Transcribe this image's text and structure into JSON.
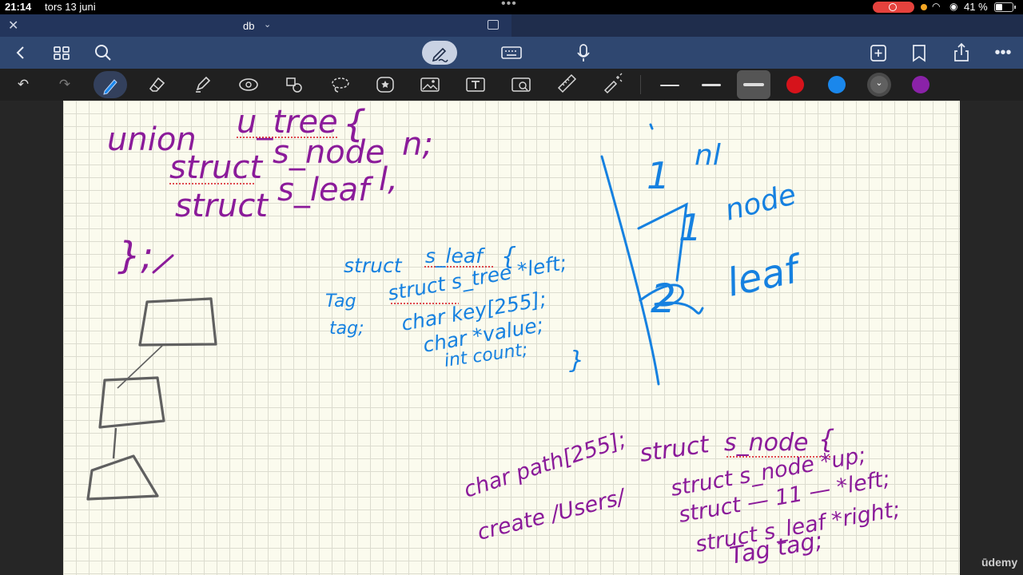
{
  "status": {
    "time": "21:14",
    "date": "tors 13 juni",
    "battery": "41 %",
    "battery_level": 0.41
  },
  "document": {
    "title": "db"
  },
  "icons": {
    "close": "close-icon",
    "back": "chevron-left-icon",
    "grid": "grid-icon",
    "search": "search-icon",
    "pen_mode": "pen-scribble-icon",
    "keyboard": "keyboard-icon",
    "mic": "microphone-icon",
    "add_page": "add-page-icon",
    "bookmark": "bookmark-icon",
    "share": "share-icon",
    "more": "more-icon",
    "undo": "undo-icon",
    "redo": "redo-icon",
    "pen": "pen-icon",
    "eraser": "eraser-icon",
    "highlighter": "highlighter-icon",
    "shapes": "shapes-icon",
    "elements": "elements-icon",
    "lasso": "lasso-icon",
    "sticker": "sticker-icon",
    "image": "image-icon",
    "text": "text-icon",
    "scan": "scan-icon",
    "ruler": "ruler-icon",
    "laser": "laser-pointer-icon"
  },
  "colors": {
    "purple": "#8b1b9a",
    "blue": "#1681e0",
    "red": "#d6131b",
    "swatch_blue": "#1a87ec",
    "gray": "#606060",
    "swatch_purple": "#8a22a8"
  },
  "notes": {
    "purple_union": {
      "line1_a": "union",
      "line1_b": "u_tree",
      "line1_c": "{",
      "line2_a": "struct",
      "line2_b": "s_node",
      "line2_c": "n;",
      "line3_a": "struct",
      "line3_b": "s_leaf",
      "line3_c": "l,",
      "close": "};"
    },
    "blue_leaf": {
      "line1_a": "struct",
      "line1_b": "s_leaf",
      "line1_c": "{",
      "line2_label": "Tag",
      "line2": "struct s_tree *left;",
      "line3_label": "tag;",
      "line3": "char key[255];",
      "line4": "char *value;",
      "line5": "int count;",
      "close": "}"
    },
    "blue_right": {
      "n1": "1",
      "n2": "1",
      "n3": "2",
      "w1": "nl",
      "w2": "node",
      "w3": "leaf"
    },
    "purple_node": {
      "line1_a": "char path[255];",
      "line1_b": "struct",
      "line1_c": "s_node",
      "line1_d": "{",
      "line2_a": "create /Users/",
      "line2_b": "struct s_node *up;",
      "line3": "struct — 11 — *left;",
      "line4": "struct s_leaf *right;",
      "line5": "Tag tag;"
    }
  },
  "watermark": "ūdemy"
}
